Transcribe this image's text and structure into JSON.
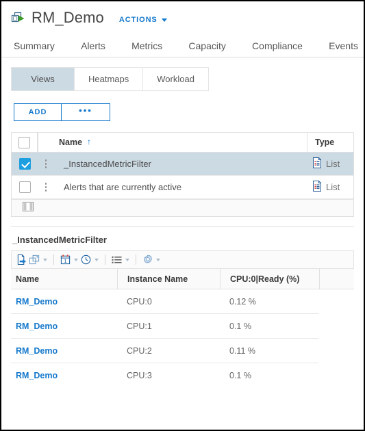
{
  "header": {
    "icon": "virtual-machine-icon",
    "title": "RM_Demo",
    "actions_label": "ACTIONS"
  },
  "main_tabs": [
    {
      "label": "Summary",
      "active": false
    },
    {
      "label": "Alerts",
      "active": false
    },
    {
      "label": "Metrics",
      "active": true
    },
    {
      "label": "Capacity",
      "active": false
    },
    {
      "label": "Compliance",
      "active": false
    },
    {
      "label": "Events",
      "active": false
    }
  ],
  "sub_tabs": [
    {
      "label": "Views",
      "active": true
    },
    {
      "label": "Heatmaps",
      "active": false
    },
    {
      "label": "Workload",
      "active": false
    }
  ],
  "toolbar_buttons": {
    "add_label": "ADD",
    "more_label": "•••"
  },
  "views_table": {
    "columns": {
      "name": "Name",
      "sort_indicator": "↑",
      "type": "Type"
    },
    "rows": [
      {
        "name": "_InstancedMetricFilter",
        "type": "List",
        "selected": true,
        "type_icon": "list-view-icon"
      },
      {
        "name": "Alerts that are currently active",
        "type": "List",
        "selected": false,
        "type_icon": "list-view-icon"
      }
    ],
    "footer_icon": "columns-layout-icon"
  },
  "detail": {
    "title": "_InstancedMetricFilter",
    "icon_toolbar": [
      {
        "name": "export-icon",
        "has_dropdown": false
      },
      {
        "name": "expand-popout-icon",
        "has_dropdown": true
      },
      {
        "name": "separator",
        "has_dropdown": false
      },
      {
        "name": "calendar-icon",
        "has_dropdown": true
      },
      {
        "name": "clock-icon",
        "has_dropdown": true
      },
      {
        "name": "separator",
        "has_dropdown": false
      },
      {
        "name": "list-options-icon",
        "has_dropdown": true
      },
      {
        "name": "separator",
        "has_dropdown": false
      },
      {
        "name": "gear-icon",
        "has_dropdown": true
      }
    ],
    "table": {
      "columns": [
        "Name",
        "Instance Name",
        "CPU:0|Ready (%)",
        ""
      ],
      "rows": [
        {
          "name": "RM_Demo",
          "instance": "CPU:0",
          "value": "0.12 %"
        },
        {
          "name": "RM_Demo",
          "instance": "CPU:1",
          "value": "0.1 %"
        },
        {
          "name": "RM_Demo",
          "instance": "CPU:2",
          "value": "0.11 %"
        },
        {
          "name": "RM_Demo",
          "instance": "CPU:3",
          "value": "0.1 %"
        }
      ]
    }
  },
  "colors": {
    "accent": "#1478cc",
    "selection": "#ccdae3",
    "checkbox_checked": "#1e9fe0",
    "vm_green": "#3c9c26",
    "text": "#4d4d4d"
  }
}
